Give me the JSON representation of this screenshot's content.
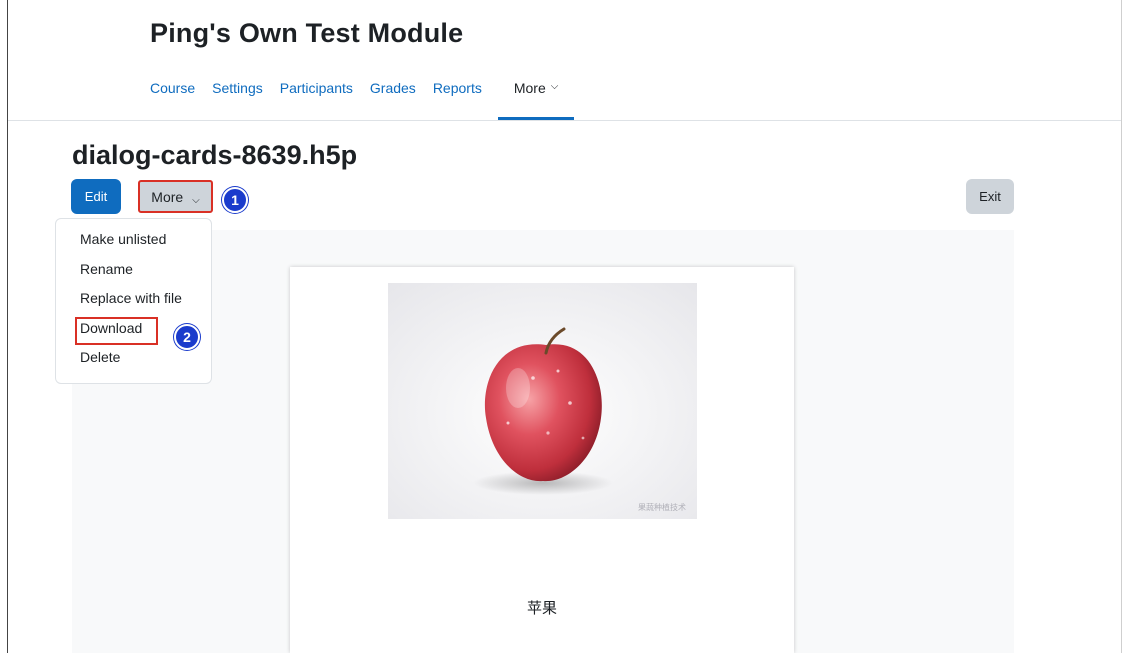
{
  "course": {
    "title": "Ping's Own Test Module",
    "nav": [
      "Course",
      "Settings",
      "Participants",
      "Grades",
      "Reports"
    ],
    "nav_more": "More"
  },
  "file": {
    "title": "dialog-cards-8639.h5p",
    "edit_label": "Edit",
    "more_label": "More",
    "exit_label": "Exit"
  },
  "dropdown": {
    "items": [
      "Make unlisted",
      "Rename",
      "Replace with file",
      "Download",
      "Delete"
    ]
  },
  "annotations": {
    "step1": "1",
    "step2": "2"
  },
  "card": {
    "text": "苹果",
    "watermark": "果蔬种植技术"
  },
  "colors": {
    "primary": "#0f6cbf",
    "highlight": "#d93025",
    "badge": "#1a3bcc"
  }
}
